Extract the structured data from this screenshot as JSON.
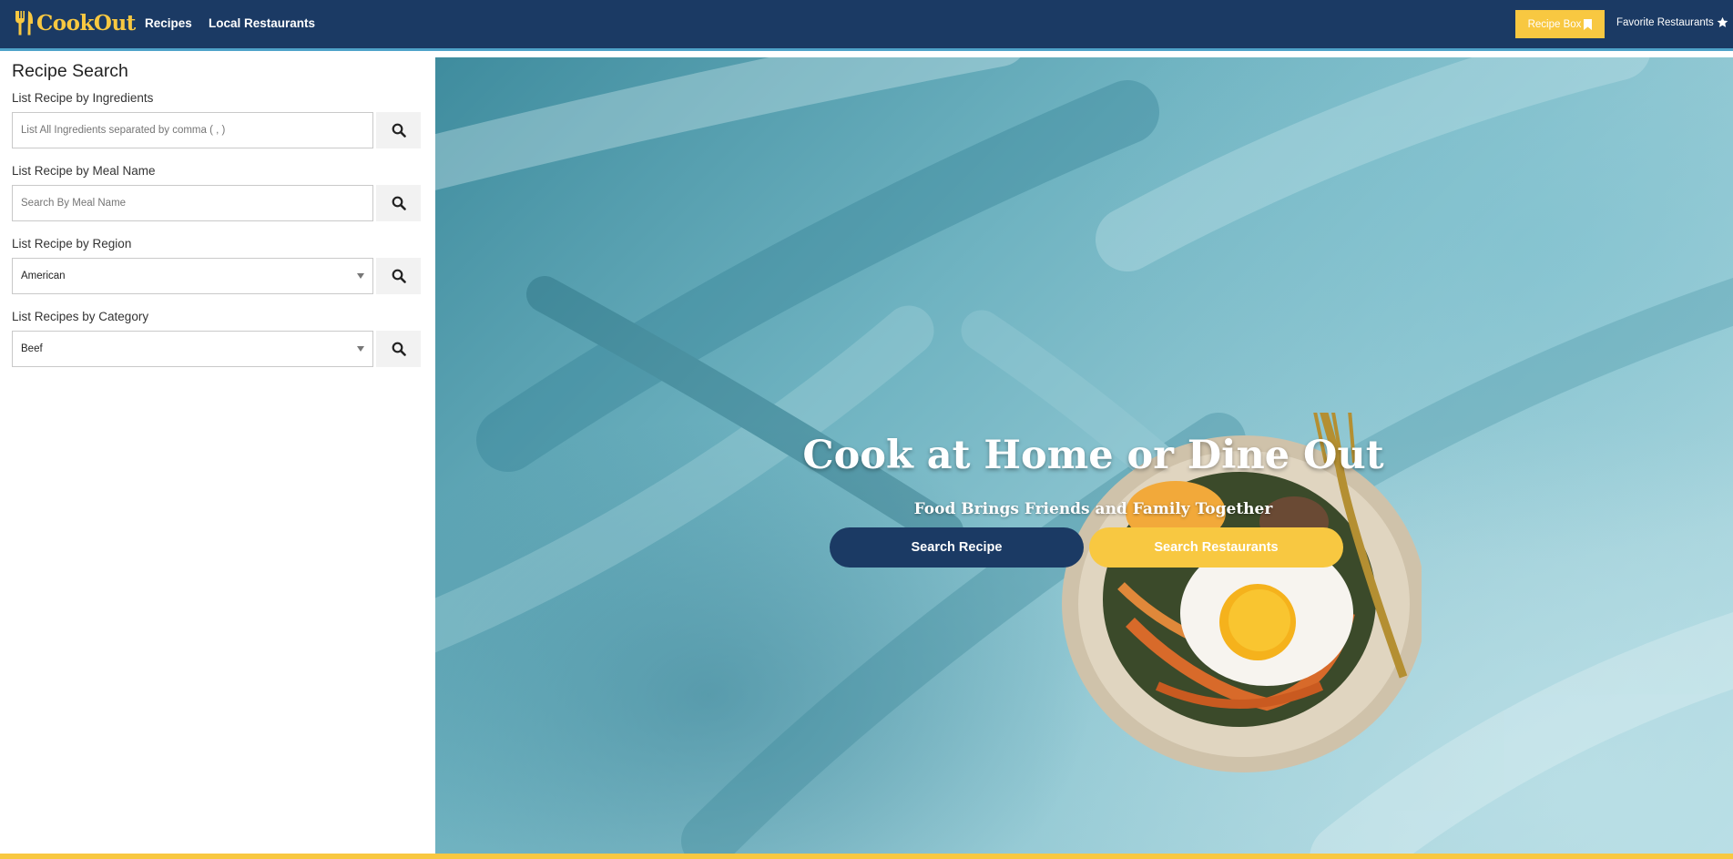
{
  "navbar": {
    "brand": "CookOut",
    "links": [
      {
        "label": "Recipes"
      },
      {
        "label": "Local Restaurants"
      }
    ],
    "recipe_box_label": "Recipe Box",
    "favorite_label": "Favorite Restaurants",
    "colors": {
      "bar": "#1b3a64",
      "accent": "#f8c841"
    }
  },
  "sidebar": {
    "title": "Recipe Search",
    "ingredients": {
      "label": "List Recipe by Ingredients",
      "placeholder": "List All Ingredients separated by comma ( , )"
    },
    "meal_name": {
      "label": "List Recipe by Meal Name",
      "placeholder": "Search By Meal Name"
    },
    "region": {
      "label": "List Recipe by Region",
      "selected": "American"
    },
    "category": {
      "label": "List Recipes by Category",
      "selected": "Beef"
    }
  },
  "hero": {
    "title": "Cook at Home or Dine Out",
    "subtitle": "Food Brings Friends and Family Together",
    "search_recipe_label": "Search Recipe",
    "search_restaurants_label": "Search Restaurants"
  }
}
